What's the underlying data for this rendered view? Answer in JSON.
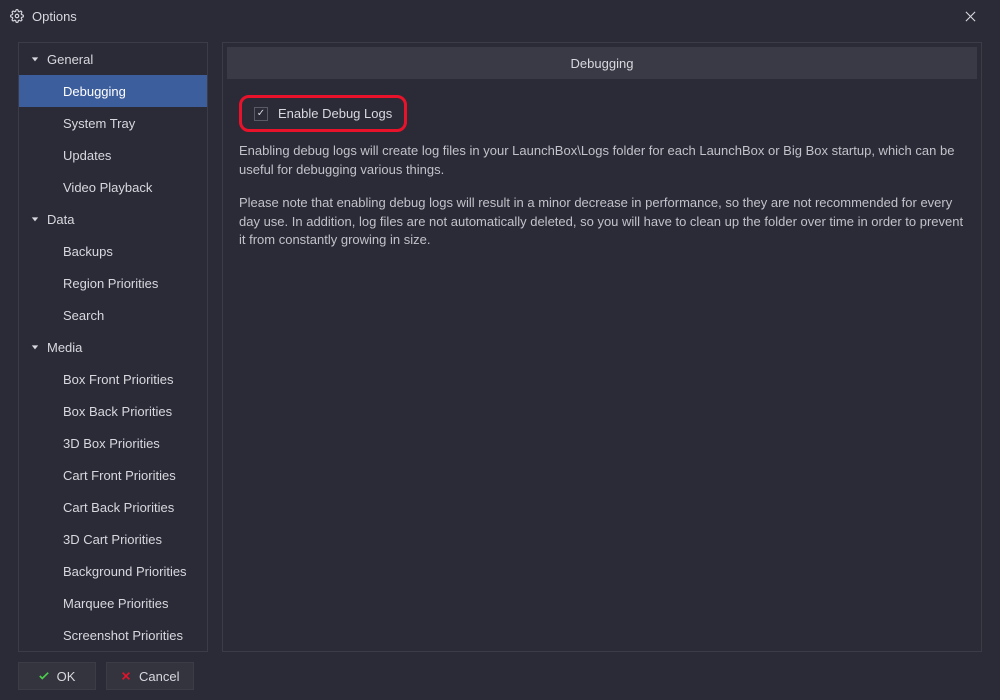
{
  "window": {
    "title": "Options"
  },
  "sidebar": {
    "sections": [
      {
        "name": "General",
        "items": [
          "Debugging",
          "System Tray",
          "Updates",
          "Video Playback"
        ],
        "selected_index": 0
      },
      {
        "name": "Data",
        "items": [
          "Backups",
          "Region Priorities",
          "Search"
        ]
      },
      {
        "name": "Media",
        "items": [
          "Box Front Priorities",
          "Box Back Priorities",
          "3D Box Priorities",
          "Cart Front Priorities",
          "Cart Back Priorities",
          "3D Cart Priorities",
          "Background Priorities",
          "Marquee Priorities",
          "Screenshot Priorities"
        ]
      }
    ]
  },
  "panel": {
    "title": "Debugging",
    "checkbox_label": "Enable Debug Logs",
    "checkbox_checked": true,
    "paragraph1": "Enabling debug logs will create log files in your LaunchBox\\Logs folder for each LaunchBox or Big Box startup, which can be useful for debugging various things.",
    "paragraph2": "Please note that enabling debug logs will result in a minor decrease in performance, so they are not recommended for every day use. In addition, log files are not automatically deleted, so you will have to clean up the folder over time in order to prevent it from constantly growing in size."
  },
  "buttons": {
    "ok": "OK",
    "cancel": "Cancel"
  },
  "annotation": {
    "highlight_checkbox": true
  }
}
